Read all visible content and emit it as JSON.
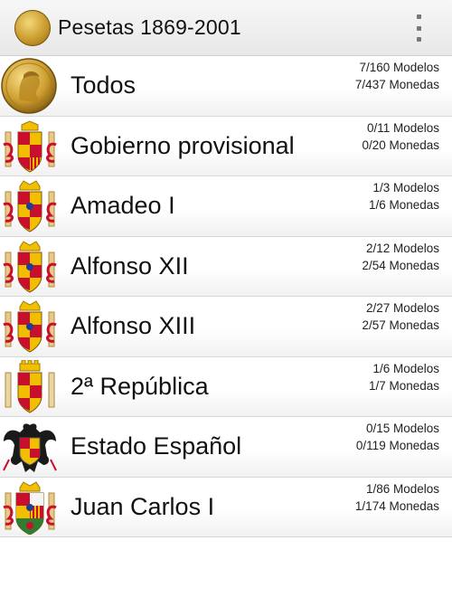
{
  "app": {
    "title": "Pesetas 1869-2001",
    "icon": "gold-coin-icon",
    "menu_icon": "overflow-menu-icon"
  },
  "colors": {
    "coin_gold": "#c99a2c",
    "spain_red": "#c8102e",
    "spain_yellow": "#f1bf00"
  },
  "items": [
    {
      "label": "Todos",
      "models": "7/160 Modelos",
      "coins": "7/437 Monedas",
      "icon": "gold-coin-portrait-icon"
    },
    {
      "label": "Gobierno provisional",
      "models": "0/11 Modelos",
      "coins": "0/20 Monedas",
      "icon": "coat-of-arms-icon"
    },
    {
      "label": "Amadeo I",
      "models": "1/3 Modelos",
      "coins": "1/6 Monedas",
      "icon": "coat-of-arms-icon"
    },
    {
      "label": "Alfonso XII",
      "models": "2/12 Modelos",
      "coins": "2/54 Monedas",
      "icon": "coat-of-arms-icon"
    },
    {
      "label": "Alfonso XIII",
      "models": "2/27 Modelos",
      "coins": "2/57 Monedas",
      "icon": "coat-of-arms-icon"
    },
    {
      "label": "2ª República",
      "models": "1/6 Modelos",
      "coins": "1/7 Monedas",
      "icon": "republic-coat-of-arms-icon"
    },
    {
      "label": "Estado Español",
      "models": "0/15 Modelos",
      "coins": "0/119 Monedas",
      "icon": "eagle-coat-of-arms-icon"
    },
    {
      "label": "Juan Carlos I",
      "models": "1/86 Modelos",
      "coins": "1/174 Monedas",
      "icon": "coat-of-arms-icon"
    }
  ]
}
